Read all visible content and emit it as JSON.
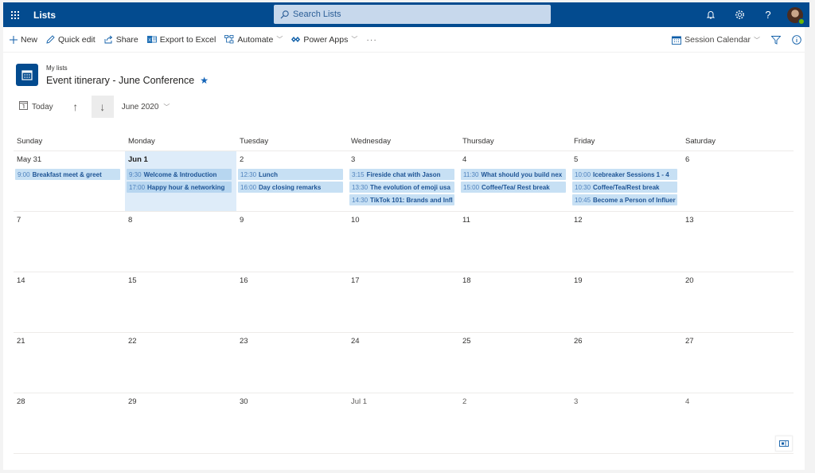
{
  "suite": {
    "app_name": "Lists",
    "search_placeholder": "Search Lists",
    "icons": [
      "waffle-icon",
      "bell-icon",
      "gear-icon",
      "help-icon",
      "avatar"
    ]
  },
  "commandbar": {
    "new": "New",
    "quick_edit": "Quick edit",
    "share": "Share",
    "export": "Export to Excel",
    "automate": "Automate",
    "power_apps": "Power Apps",
    "more": "···",
    "view_name": "Session Calendar"
  },
  "header": {
    "breadcrumb": "My lists",
    "title": "Event itinerary - June Conference"
  },
  "calnav": {
    "today": "Today",
    "month": "June 2020"
  },
  "calendar": {
    "weekdays": [
      "Sunday",
      "Monday",
      "Tuesday",
      "Wednesday",
      "Thursday",
      "Friday",
      "Saturday"
    ],
    "accent_color": "#034b8f",
    "event_color": "#c7e0f4",
    "weeks": [
      [
        {
          "label": "May 31",
          "other": false,
          "events": [
            {
              "time": "9:00",
              "title": "Breakfast meet & greet"
            }
          ]
        },
        {
          "label": "Jun 1",
          "selected": true,
          "events": [
            {
              "time": "9:30",
              "title": "Welcome & Introduction"
            },
            {
              "time": "17:00",
              "title": "Happy hour & networking"
            }
          ]
        },
        {
          "label": "2",
          "events": [
            {
              "time": "12:30",
              "title": "Lunch"
            },
            {
              "time": "16:00",
              "title": "Day closing remarks"
            }
          ]
        },
        {
          "label": "3",
          "events": [
            {
              "time": "3:15",
              "title": "Fireside chat with Jason"
            },
            {
              "time": "13:30",
              "title": "The evolution of emoji usa"
            },
            {
              "time": "14:30",
              "title": "TikTok 101: Brands and Infl"
            }
          ]
        },
        {
          "label": "4",
          "events": [
            {
              "time": "11:30",
              "title": "What should you build nex"
            },
            {
              "time": "15:00",
              "title": "Coffee/Tea/ Rest break"
            }
          ]
        },
        {
          "label": "5",
          "events": [
            {
              "time": "10:00",
              "title": "Icebreaker Sessions 1 - 4"
            },
            {
              "time": "10:30",
              "title": "Coffee/Tea/Rest break"
            },
            {
              "time": "10:45",
              "title": "Become a Person of Influer"
            }
          ]
        },
        {
          "label": "6",
          "events": []
        }
      ],
      [
        {
          "label": "7",
          "events": []
        },
        {
          "label": "8",
          "events": []
        },
        {
          "label": "9",
          "events": []
        },
        {
          "label": "10",
          "events": []
        },
        {
          "label": "11",
          "events": []
        },
        {
          "label": "12",
          "events": []
        },
        {
          "label": "13",
          "events": []
        }
      ],
      [
        {
          "label": "14",
          "events": []
        },
        {
          "label": "15",
          "events": []
        },
        {
          "label": "16",
          "events": []
        },
        {
          "label": "17",
          "events": []
        },
        {
          "label": "18",
          "events": []
        },
        {
          "label": "19",
          "events": []
        },
        {
          "label": "20",
          "events": []
        }
      ],
      [
        {
          "label": "21",
          "events": []
        },
        {
          "label": "22",
          "events": []
        },
        {
          "label": "23",
          "events": []
        },
        {
          "label": "24",
          "events": []
        },
        {
          "label": "25",
          "events": []
        },
        {
          "label": "26",
          "events": []
        },
        {
          "label": "27",
          "events": []
        }
      ],
      [
        {
          "label": "28",
          "events": []
        },
        {
          "label": "29",
          "events": []
        },
        {
          "label": "30",
          "events": []
        },
        {
          "label": "Jul 1",
          "other": true,
          "events": []
        },
        {
          "label": "2",
          "other": true,
          "events": []
        },
        {
          "label": "3",
          "other": true,
          "events": []
        },
        {
          "label": "4",
          "other": true,
          "events": []
        }
      ]
    ]
  }
}
